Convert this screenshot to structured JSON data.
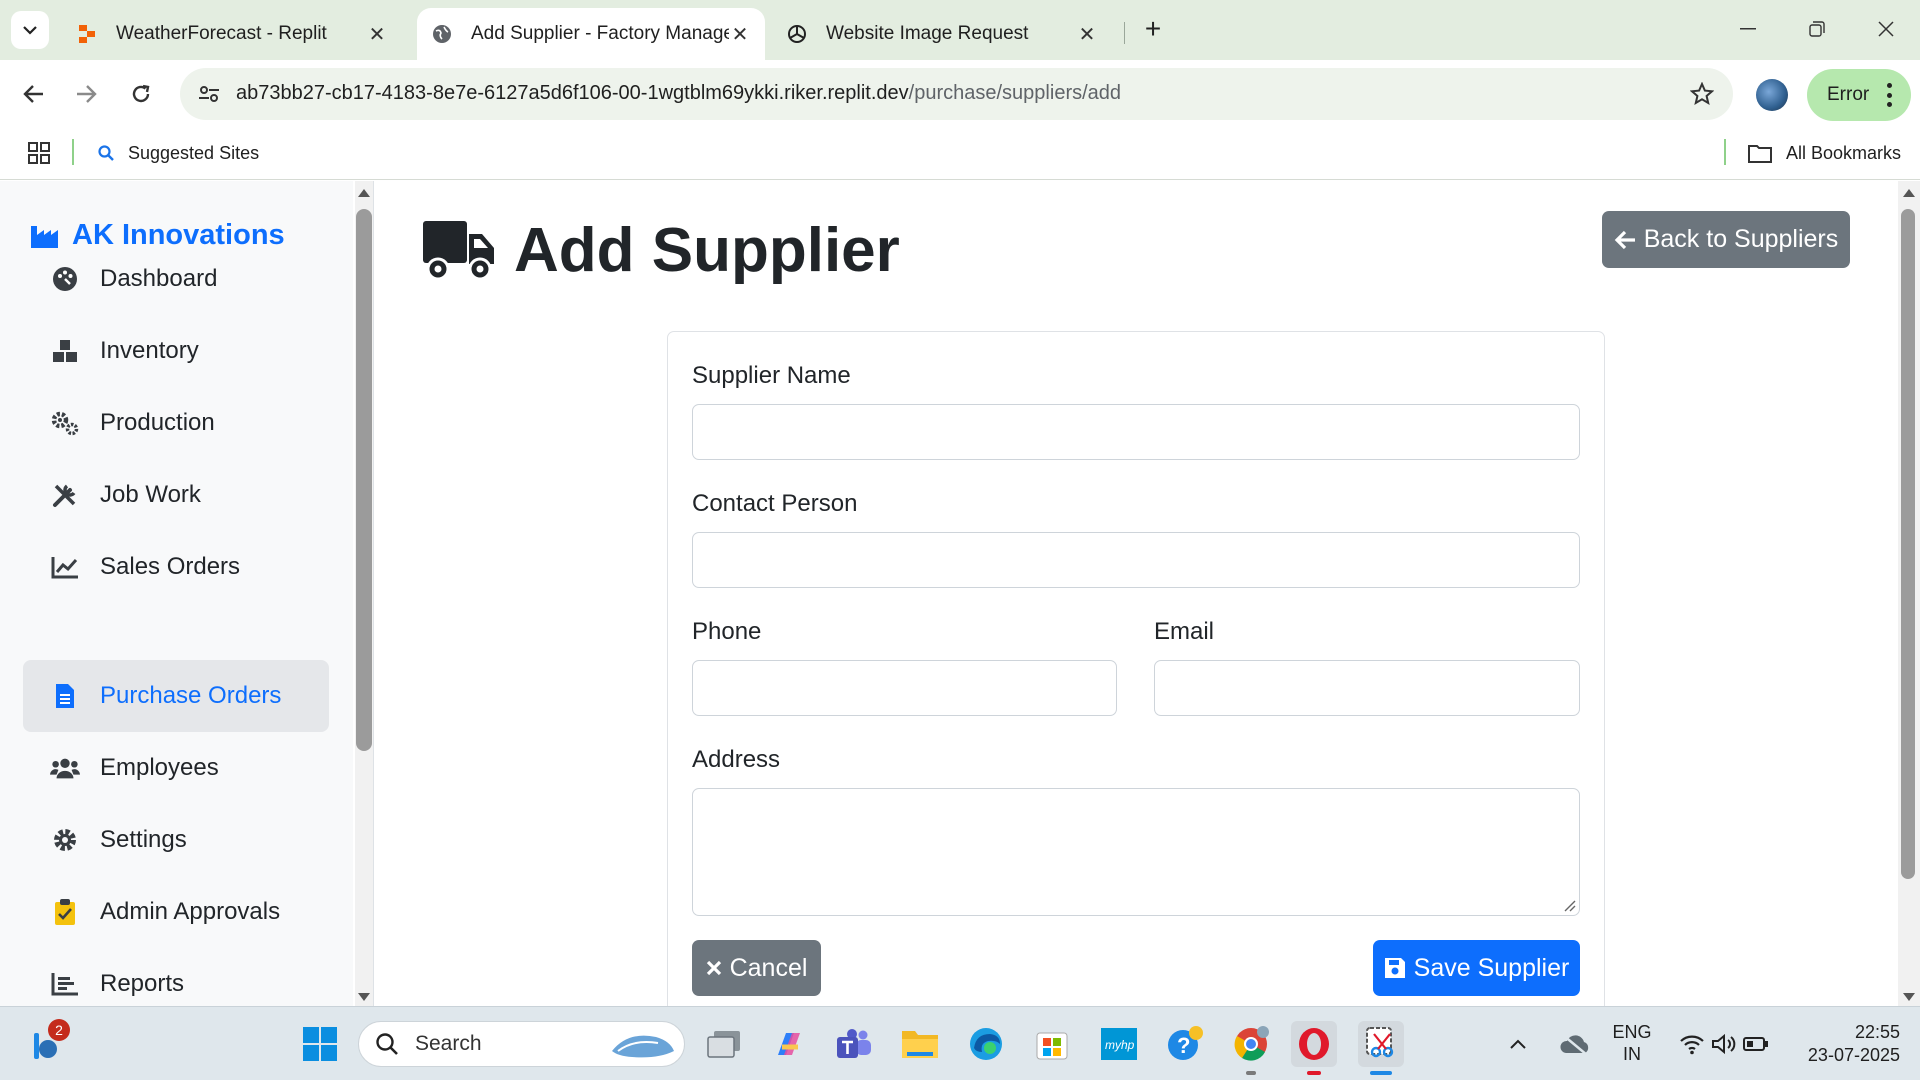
{
  "browser": {
    "tabs": [
      {
        "title": "WeatherForecast - Replit",
        "active": false
      },
      {
        "title": "Add Supplier - Factory Manage",
        "active": true
      },
      {
        "title": "Website Image Request",
        "active": false
      }
    ],
    "url_host": "ab73bb27-cb17-4183-8e7e-6127a5d6f106-00-1wgtblm69ykki.riker.replit.dev",
    "url_path": "/purchase/suppliers/add",
    "profile_status": "Error",
    "bookmarks": {
      "suggested": "Suggested Sites",
      "all": "All Bookmarks"
    }
  },
  "sidebar": {
    "brand": "AK Innovations",
    "items": [
      {
        "label": "Dashboard",
        "icon": "palette-icon",
        "active": false
      },
      {
        "label": "Inventory",
        "icon": "boxes-icon",
        "active": false
      },
      {
        "label": "Production",
        "icon": "gears-icon",
        "active": false
      },
      {
        "label": "Job Work",
        "icon": "tools-icon",
        "active": false
      },
      {
        "label": "Sales Orders",
        "icon": "line-chart-icon",
        "active": false
      },
      {
        "label": "Purchase Orders",
        "icon": "document-icon",
        "active": true
      },
      {
        "label": "Employees",
        "icon": "users-icon",
        "active": false
      },
      {
        "label": "Settings",
        "icon": "gear-icon",
        "active": false
      },
      {
        "label": "Admin Approvals",
        "icon": "clipboard-check-icon",
        "active": false
      },
      {
        "label": "Reports",
        "icon": "bar-chart-icon",
        "active": false
      }
    ]
  },
  "main": {
    "title": "Add Supplier",
    "back_button": "Back to Suppliers",
    "form": {
      "supplier_name_label": "Supplier Name",
      "supplier_name_value": "",
      "contact_person_label": "Contact Person",
      "contact_person_value": "",
      "phone_label": "Phone",
      "phone_value": "",
      "email_label": "Email",
      "email_value": "",
      "address_label": "Address",
      "address_value": "",
      "cancel_label": "Cancel",
      "save_label": "Save Supplier"
    }
  },
  "colors": {
    "primary": "#0d6efd",
    "secondary": "#6c757d",
    "sidebar_bg": "#f8f9fa",
    "chrome_bg": "#e3ede0"
  },
  "taskbar": {
    "notification_count": "2",
    "search_placeholder": "Search",
    "lang_line1": "ENG",
    "lang_line2": "IN",
    "time": "22:55",
    "date": "23-07-2025"
  }
}
